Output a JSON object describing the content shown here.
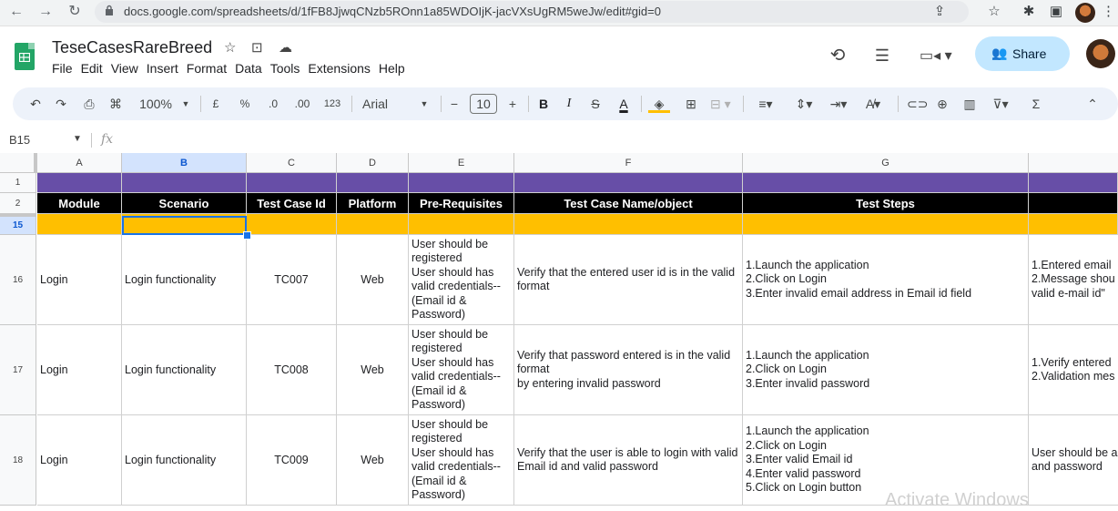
{
  "browser": {
    "url": "docs.google.com/spreadsheets/d/1fFB8JjwqCNzb5ROnn1a85WDOIjK-jacVXsUgRM5weJw/edit#gid=0"
  },
  "doc": {
    "title": "TeseCasesRareBreed",
    "menu": [
      "File",
      "Edit",
      "View",
      "Insert",
      "Format",
      "Data",
      "Tools",
      "Extensions",
      "Help"
    ],
    "share_label": "Share"
  },
  "toolbar": {
    "zoom": "100%",
    "currency": "£",
    "percent": "%",
    "dec_decrease": ".0",
    "dec_increase": ".00",
    "number_format": "123",
    "font": "Arial",
    "font_size": "10",
    "bold": "B",
    "italic": "I",
    "text_color": "A",
    "sum": "Σ"
  },
  "formula_bar": {
    "name_box": "B15",
    "fx": "fx"
  },
  "grid": {
    "columns": [
      "A",
      "B",
      "C",
      "D",
      "E",
      "F",
      "G"
    ],
    "selected_column": "B",
    "row_numbers": [
      "1",
      "2",
      "15",
      "16",
      "17",
      "18"
    ],
    "selected_row": "15",
    "header_row": [
      "Module",
      "Scenario",
      "Test Case Id",
      "Platform",
      "Pre-Requisites",
      "Test Case Name/object",
      "Test Steps",
      ""
    ],
    "rows": [
      {
        "module": "Login",
        "scenario": "Login functionality",
        "id": "TC007",
        "platform": "Web",
        "prereq": "User should be registered\nUser should has valid credentials--(Email id & Password)",
        "name": "Verify that the entered user id is in the valid format",
        "steps": "1.Launch the application\n2.Click on Login\n3.Enter invalid email address in Email id field",
        "expected": "1.Entered email\n2.Message shou\nvalid e-mail id\""
      },
      {
        "module": "Login",
        "scenario": "Login functionality",
        "id": "TC008",
        "platform": "Web",
        "prereq": "User should be registered\nUser should has valid credentials--(Email id & Password)",
        "name": "Verify that password entered is in the valid format\nby entering invalid password",
        "steps": "1.Launch the application\n2.Click on Login\n3.Enter invalid password",
        "expected": "1.Verify entered\n2.Validation mes"
      },
      {
        "module": "Login",
        "scenario": "Login functionality",
        "id": "TC009",
        "platform": "Web",
        "prereq": "User should be registered\nUser should has valid credentials--(Email id & Password)",
        "name": "Verify that the user is able to login with valid Email id and valid password",
        "steps": "1.Launch the application\n2.Click on Login\n3.Enter valid Email id\n4.Enter valid password\n5.Click on Login button",
        "expected": "User should be a\nand password"
      }
    ]
  },
  "watermark": "Activate Windows",
  "colors": {
    "header_purple": "#674ea7",
    "header_black": "#000000",
    "row_highlight": "#ffbf00",
    "selection": "#1a73e8",
    "share_bg": "#c2e7ff"
  }
}
